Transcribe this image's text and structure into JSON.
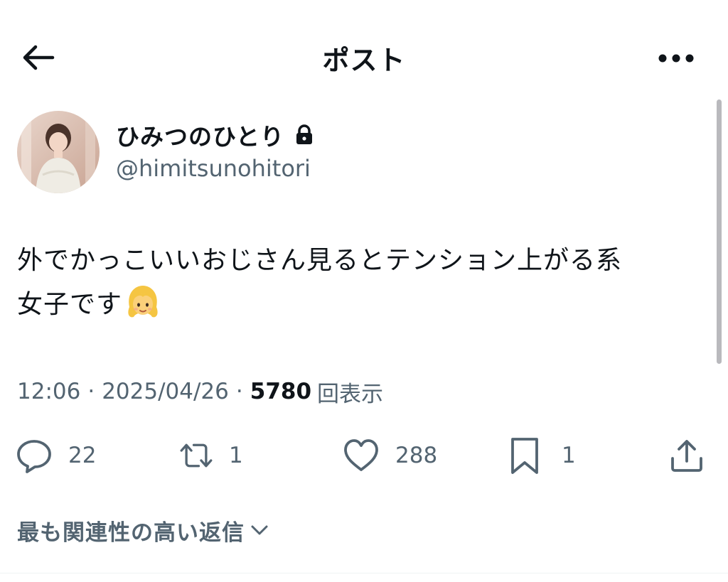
{
  "header": {
    "title": "ポスト",
    "back_icon": "arrow-left-icon",
    "more_icon": "more-horizontal-icon"
  },
  "author": {
    "display_name": "ひみつのひとり",
    "handle": "@himitsunohitori",
    "protected": true
  },
  "post": {
    "text_line1": "外でかっこいいおじさん見るとテンション上がる系",
    "text_line2": "女子です",
    "emoji": "girl-emoji"
  },
  "meta": {
    "time": "12:06",
    "separator": "·",
    "date": "2025/04/26",
    "views": "5780",
    "views_label": "回表示"
  },
  "actions": {
    "replies": "22",
    "reposts": "1",
    "likes": "288",
    "bookmarks": "1"
  },
  "replies_filter": {
    "label": "最も関連性の高い返信"
  },
  "colors": {
    "text": "#0f1419",
    "secondary": "#536471",
    "divider": "#eff3f4"
  }
}
